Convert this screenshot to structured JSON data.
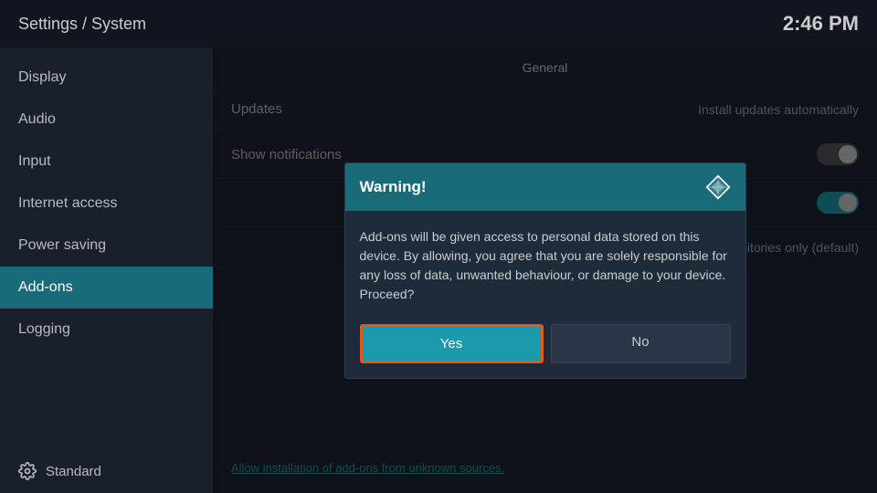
{
  "header": {
    "title": "Settings / System",
    "time": "2:46 PM"
  },
  "sidebar": {
    "items": [
      {
        "id": "display",
        "label": "Display",
        "active": false
      },
      {
        "id": "audio",
        "label": "Audio",
        "active": false
      },
      {
        "id": "input",
        "label": "Input",
        "active": false
      },
      {
        "id": "internet-access",
        "label": "Internet access",
        "active": false
      },
      {
        "id": "power-saving",
        "label": "Power saving",
        "active": false
      },
      {
        "id": "add-ons",
        "label": "Add-ons",
        "active": true
      },
      {
        "id": "logging",
        "label": "Logging",
        "active": false
      }
    ],
    "footer_label": "Standard"
  },
  "main": {
    "section_label": "General",
    "rows": [
      {
        "label": "Updates",
        "value": "Install updates automatically",
        "type": "text"
      },
      {
        "label": "Show notifications",
        "value": "",
        "type": "toggle-off"
      },
      {
        "label": "",
        "value": "",
        "type": "toggle-on-dim"
      },
      {
        "label": "",
        "value": "Official repositories only (default)",
        "type": "text-dim"
      }
    ],
    "bottom_link": "Allow installation of add-ons from unknown sources."
  },
  "dialog": {
    "title": "Warning!",
    "message": "Add-ons will be given access to personal data stored on this device. By allowing, you agree that you are solely responsible for any loss of data, unwanted behaviour, or damage to your device. Proceed?",
    "yes_label": "Yes",
    "no_label": "No"
  }
}
